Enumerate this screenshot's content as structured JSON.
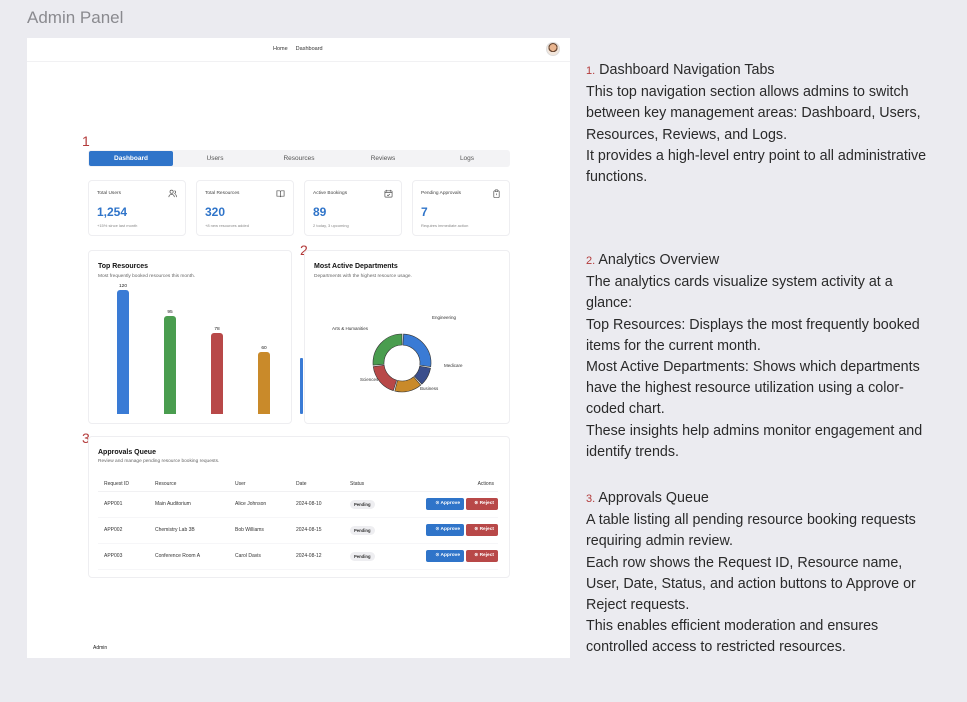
{
  "page_title": "Admin Panel",
  "topnav": {
    "links": [
      "Home",
      "Dashboard"
    ],
    "avatar_icon": "user-avatar"
  },
  "markers": [
    "1",
    "2",
    "3"
  ],
  "tabs": [
    "Dashboard",
    "Users",
    "Resources",
    "Reviews",
    "Logs"
  ],
  "stats": [
    {
      "label": "Total Users",
      "value": "1,254",
      "sub": "+15% since last month",
      "icon": "users-icon"
    },
    {
      "label": "Total Resources",
      "value": "320",
      "sub": "+8 new resources added",
      "icon": "book-icon"
    },
    {
      "label": "Active Bookings",
      "value": "89",
      "sub": "2 today, 3 upcoming",
      "icon": "calendar-icon"
    },
    {
      "label": "Pending Approvals",
      "value": "7",
      "sub": "Requires immediate action",
      "icon": "clipboard-icon"
    }
  ],
  "top_resources": {
    "title": "Top Resources",
    "desc": "Most frequently booked resources this month.",
    "chart_data": {
      "type": "bar",
      "values": [
        120,
        95,
        78,
        60
      ],
      "colors": [
        "#3a7bd5",
        "#4a9d4f",
        "#b84848",
        "#c98a2a"
      ],
      "ylim": [
        0,
        120
      ]
    }
  },
  "departments": {
    "title": "Most Active Departments",
    "desc": "Departments with the highest resource usage.",
    "chart_data": {
      "type": "pie",
      "labels": [
        "Engineering",
        "Medicare",
        "Business",
        "Sciences",
        "Arts & Humanities"
      ],
      "values": [
        27,
        11,
        16,
        19,
        27
      ],
      "colors": [
        "#3a7bd5",
        "#3a4e8c",
        "#c98a2a",
        "#b84848",
        "#4a9d4f"
      ]
    }
  },
  "approvals": {
    "title": "Approvals Queue",
    "desc": "Review and manage pending resource booking requests.",
    "headers": [
      "Request ID",
      "Resource",
      "User",
      "Date",
      "Status",
      "Actions"
    ],
    "rows": [
      [
        "APP001",
        "Main Auditorium",
        "Alice Johnson",
        "2024-08-10",
        "Pending"
      ],
      [
        "APP002",
        "Chemistry Lab 3B",
        "Bob Williams",
        "2024-08-15",
        "Pending"
      ],
      [
        "APP003",
        "Conference Room A",
        "Carol Davis",
        "2024-08-12",
        "Pending"
      ]
    ],
    "approve_label": "Approve",
    "reject_label": "Reject"
  },
  "footer": "Admin",
  "notes": [
    {
      "num": "1.",
      "title": "Dashboard Navigation Tabs",
      "lines": [
        "This top navigation section allows admins to switch between key management areas: Dashboard, Users, Resources, Reviews, and Logs.",
        "It provides a high-level entry point to all administrative functions."
      ]
    },
    {
      "num": "2.",
      "title": "Analytics Overview",
      "lines": [
        "The analytics cards visualize system activity at a glance:",
        "Top Resources: Displays the most frequently booked items for the current month.",
        "Most Active Departments: Shows which departments have the highest resource utilization using a color-coded chart.",
        "These insights help admins monitor engagement and identify trends."
      ]
    },
    {
      "num": "3.",
      "title": "Approvals Queue",
      "lines": [
        "A table listing all pending resource booking requests requiring admin review.",
        "Each row shows the Request ID, Resource name, User, Date, Status, and action buttons to Approve or Reject requests.",
        "This enables efficient moderation and ensures controlled access to restricted resources."
      ]
    }
  ]
}
